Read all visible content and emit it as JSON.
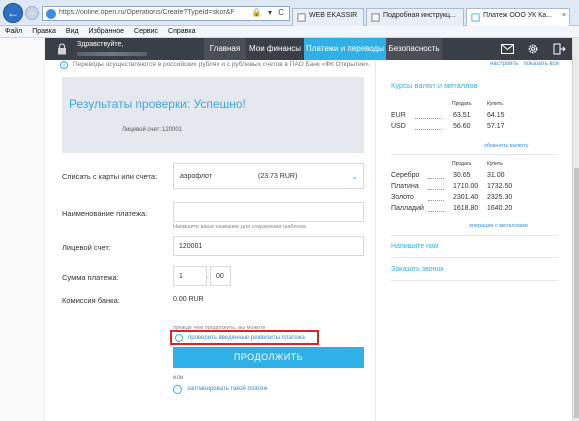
{
  "browser": {
    "url": "https://online.open.ru/Operations/Create?TypeId=skor&ProviderId=9438",
    "tabs": [
      {
        "label": "WEB EKASSIR",
        "active": false
      },
      {
        "label": "Подробная инструкц...",
        "active": false
      },
      {
        "label": "Платеж ООО УК Ка...",
        "active": true
      }
    ],
    "menu": [
      "Файл",
      "Правка",
      "Вид",
      "Избранное",
      "Сервис",
      "Справка"
    ]
  },
  "header": {
    "greeting": "Здравствуйте,",
    "nav": [
      "Главная",
      "Мои финансы",
      "Платежи и переводы",
      "Безопасность"
    ],
    "active_nav": "Платежи и переводы"
  },
  "notice": "Переводы осуществляются в российских рублях и с рублевых счетов в ПАО Банк «ФК Открытие».",
  "result": {
    "title": "Результаты проверки:  Успешно!",
    "account_label": "Лицевой счет:",
    "account_value": "120001"
  },
  "form": {
    "debit_label": "Списать с карты или счета:",
    "debit_name": "аэрофлот",
    "debit_amount": "(23.73  RUR)",
    "payment_name_label": "Наименование платежа:",
    "payment_name_hint": "Напишите ваше название для сохранения шаблона",
    "account_label": "Лицевой счет:",
    "account_value": "120001",
    "amount_label": "Сумма платежа:",
    "amount_rub": "1",
    "amount_kop": "00",
    "commission_label": "Комиссия банка:",
    "commission_value": "0.00 RUR",
    "before_continue": "прежде чем продолжить, вы можете",
    "check_details_link": "проверить введенные реквизиты платежа",
    "continue_button": "ПРОДОЛЖИТЬ",
    "or_text": "или",
    "plan_link": "запланировать такой платеж"
  },
  "sidebar": {
    "configure_link": "настроить",
    "show_all_link": "показать все",
    "rates_title": "Курсы валют и металлов",
    "buy_header": "Продать",
    "sell_header": "Купить",
    "currencies": [
      {
        "name": "EUR",
        "buy": "63.51",
        "sell": "64.15"
      },
      {
        "name": "USD",
        "buy": "56.60",
        "sell": "57.17"
      }
    ],
    "currency_exchange_link": "обменять валюту",
    "metals": [
      {
        "name": "Серебро",
        "buy": "30.65",
        "sell": "31.00"
      },
      {
        "name": "Платина",
        "buy": "1710.00",
        "sell": "1732.50"
      },
      {
        "name": "Золото",
        "buy": "2301.40",
        "sell": "2325.30"
      },
      {
        "name": "Палладий",
        "buy": "1618.80",
        "sell": "1640.20"
      }
    ],
    "metal_ops_link": "операции с металлами",
    "write_us": "Напишите нам",
    "order_call": "Заказать звонок"
  }
}
